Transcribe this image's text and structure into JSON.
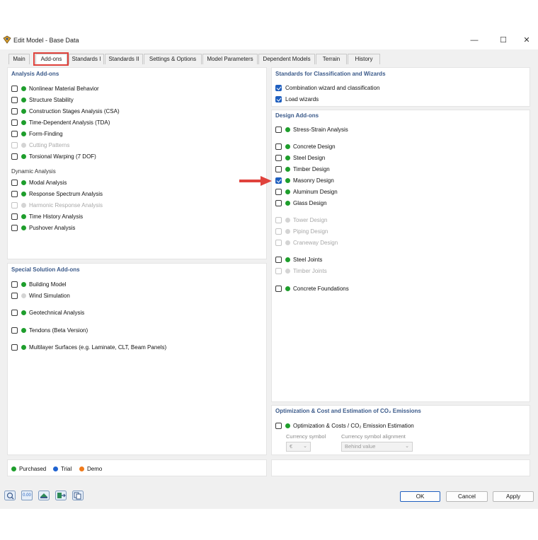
{
  "window": {
    "title": "Edit Model - Base Data",
    "minimize_glyph": "—",
    "maximize_glyph": "☐",
    "close_glyph": "✕"
  },
  "tabs": [
    {
      "label": "Main"
    },
    {
      "label": "Add-ons"
    },
    {
      "label": "Standards I"
    },
    {
      "label": "Standards II"
    },
    {
      "label": "Settings & Options"
    },
    {
      "label": "Model Parameters"
    },
    {
      "label": "Dependent Models"
    },
    {
      "label": "Terrain"
    },
    {
      "label": "History"
    }
  ],
  "active_tab": "Add-ons",
  "colors": {
    "purchased": "#1e9e2c",
    "trial": "#1f63d1",
    "demo": "#f07a1a",
    "inactive": "#d4d4d4",
    "highlight": "#e0423c",
    "section_title": "#3b5a8a"
  },
  "analysis_addons": {
    "title": "Analysis Add-ons",
    "items": [
      {
        "label": "Nonlinear Material Behavior",
        "checked": false,
        "enabled": true,
        "status": "purchased"
      },
      {
        "label": "Structure Stability",
        "checked": false,
        "enabled": true,
        "status": "purchased"
      },
      {
        "label": "Construction Stages Analysis (CSA)",
        "checked": false,
        "enabled": true,
        "status": "purchased"
      },
      {
        "label": "Time-Dependent Analysis (TDA)",
        "checked": false,
        "enabled": true,
        "status": "purchased"
      },
      {
        "label": "Form-Finding",
        "checked": false,
        "enabled": true,
        "status": "purchased"
      },
      {
        "label": "Cutting Patterns",
        "checked": false,
        "enabled": false,
        "status": "inactive"
      },
      {
        "label": "Torsional Warping (7 DOF)",
        "checked": false,
        "enabled": true,
        "status": "purchased"
      }
    ],
    "dynamic_title": "Dynamic Analysis",
    "dynamic_items": [
      {
        "label": "Modal Analysis",
        "checked": false,
        "enabled": true,
        "status": "purchased"
      },
      {
        "label": "Response Spectrum Analysis",
        "checked": false,
        "enabled": true,
        "status": "purchased"
      },
      {
        "label": "Harmonic Response Analysis",
        "checked": false,
        "enabled": false,
        "status": "inactive"
      },
      {
        "label": "Time History Analysis",
        "checked": false,
        "enabled": true,
        "status": "purchased"
      },
      {
        "label": "Pushover Analysis",
        "checked": false,
        "enabled": true,
        "status": "purchased"
      }
    ]
  },
  "special_addons": {
    "title": "Special Solution Add-ons",
    "items": [
      {
        "label": "Building Model",
        "checked": false,
        "enabled": true,
        "status": "purchased"
      },
      {
        "label": "Wind Simulation",
        "checked": false,
        "enabled": true,
        "status": "inactive"
      },
      {
        "label": "Geotechnical Analysis",
        "checked": false,
        "enabled": true,
        "status": "purchased"
      },
      {
        "label": "Tendons (Beta Version)",
        "checked": false,
        "enabled": true,
        "status": "purchased"
      },
      {
        "label": "Multilayer Surfaces (e.g. Laminate, CLT, Beam Panels)",
        "checked": false,
        "enabled": true,
        "status": "purchased"
      }
    ]
  },
  "standards_wizards": {
    "title": "Standards for Classification and Wizards",
    "items": [
      {
        "label": "Combination wizard and classification",
        "checked": true
      },
      {
        "label": "Load wizards",
        "checked": true
      }
    ]
  },
  "design_addons": {
    "title": "Design Add-ons",
    "items": [
      {
        "label": "Stress-Strain Analysis",
        "checked": false,
        "enabled": true,
        "status": "purchased"
      },
      {
        "label": "Concrete Design",
        "checked": false,
        "enabled": true,
        "status": "purchased"
      },
      {
        "label": "Steel Design",
        "checked": false,
        "enabled": true,
        "status": "purchased"
      },
      {
        "label": "Timber Design",
        "checked": false,
        "enabled": true,
        "status": "purchased"
      },
      {
        "label": "Masonry Design",
        "checked": true,
        "enabled": true,
        "status": "purchased"
      },
      {
        "label": "Aluminum Design",
        "checked": false,
        "enabled": true,
        "status": "purchased"
      },
      {
        "label": "Glass Design",
        "checked": false,
        "enabled": true,
        "status": "purchased"
      },
      {
        "label": "Tower Design",
        "checked": false,
        "enabled": false,
        "status": "inactive"
      },
      {
        "label": "Piping Design",
        "checked": false,
        "enabled": false,
        "status": "inactive"
      },
      {
        "label": "Craneway Design",
        "checked": false,
        "enabled": false,
        "status": "inactive"
      },
      {
        "label": "Steel Joints",
        "checked": false,
        "enabled": true,
        "status": "purchased"
      },
      {
        "label": "Timber Joints",
        "checked": false,
        "enabled": false,
        "status": "inactive"
      },
      {
        "label": "Concrete Foundations",
        "checked": false,
        "enabled": true,
        "status": "purchased"
      }
    ]
  },
  "optimization": {
    "title": "Optimization & Cost and Estimation of CO₂ Emissions",
    "item": {
      "label": "Optimization & Costs / CO₂ Emission Estimation",
      "checked": false,
      "status": "purchased"
    },
    "currency_symbol_label": "Currency symbol",
    "currency_symbol_value": "€",
    "alignment_label": "Currency symbol alignment",
    "alignment_value": "Behind value"
  },
  "legend": [
    {
      "label": "Purchased",
      "status": "purchased"
    },
    {
      "label": "Trial",
      "status": "trial"
    },
    {
      "label": "Demo",
      "status": "demo"
    }
  ],
  "footer": {
    "ok_label": "OK",
    "cancel_label": "Cancel",
    "apply_label": "Apply",
    "value_icon_text": "0.00",
    "tool_icons": [
      "help-icon",
      "units-icon",
      "model-import-icon",
      "model-export-icon",
      "copy-icon"
    ]
  }
}
